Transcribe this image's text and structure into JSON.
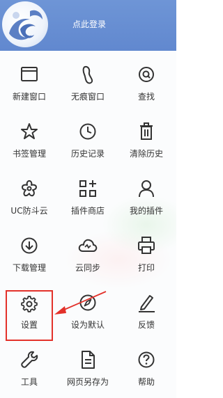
{
  "header": {
    "login_label": "点此登录",
    "bg_color": "#6188cf"
  },
  "menu": {
    "items": [
      {
        "label": "新建窗口",
        "icon": "window-icon"
      },
      {
        "label": "无痕窗口",
        "icon": "footprint-icon"
      },
      {
        "label": "查找",
        "icon": "search-icon"
      },
      {
        "label": "书签管理",
        "icon": "star-icon"
      },
      {
        "label": "历史记录",
        "icon": "clock-icon"
      },
      {
        "label": "清除历史",
        "icon": "trash-icon"
      },
      {
        "label": "UC防斗云",
        "icon": "flower-icon"
      },
      {
        "label": "插件商店",
        "icon": "grid-plus-icon"
      },
      {
        "label": "我的插件",
        "icon": "user-icon"
      },
      {
        "label": "下载管理",
        "icon": "download-icon"
      },
      {
        "label": "云同步",
        "icon": "cloud-sync-icon"
      },
      {
        "label": "打印",
        "icon": "printer-icon"
      },
      {
        "label": "设置",
        "icon": "gear-icon"
      },
      {
        "label": "设为默认",
        "icon": "compass-icon"
      },
      {
        "label": "反馈",
        "icon": "pen-icon"
      },
      {
        "label": "工具",
        "icon": "wrench-icon"
      },
      {
        "label": "网页另存为",
        "icon": "document-icon"
      },
      {
        "label": "帮助",
        "icon": "help-icon"
      }
    ]
  },
  "annotation": {
    "color": "#e3312a"
  }
}
